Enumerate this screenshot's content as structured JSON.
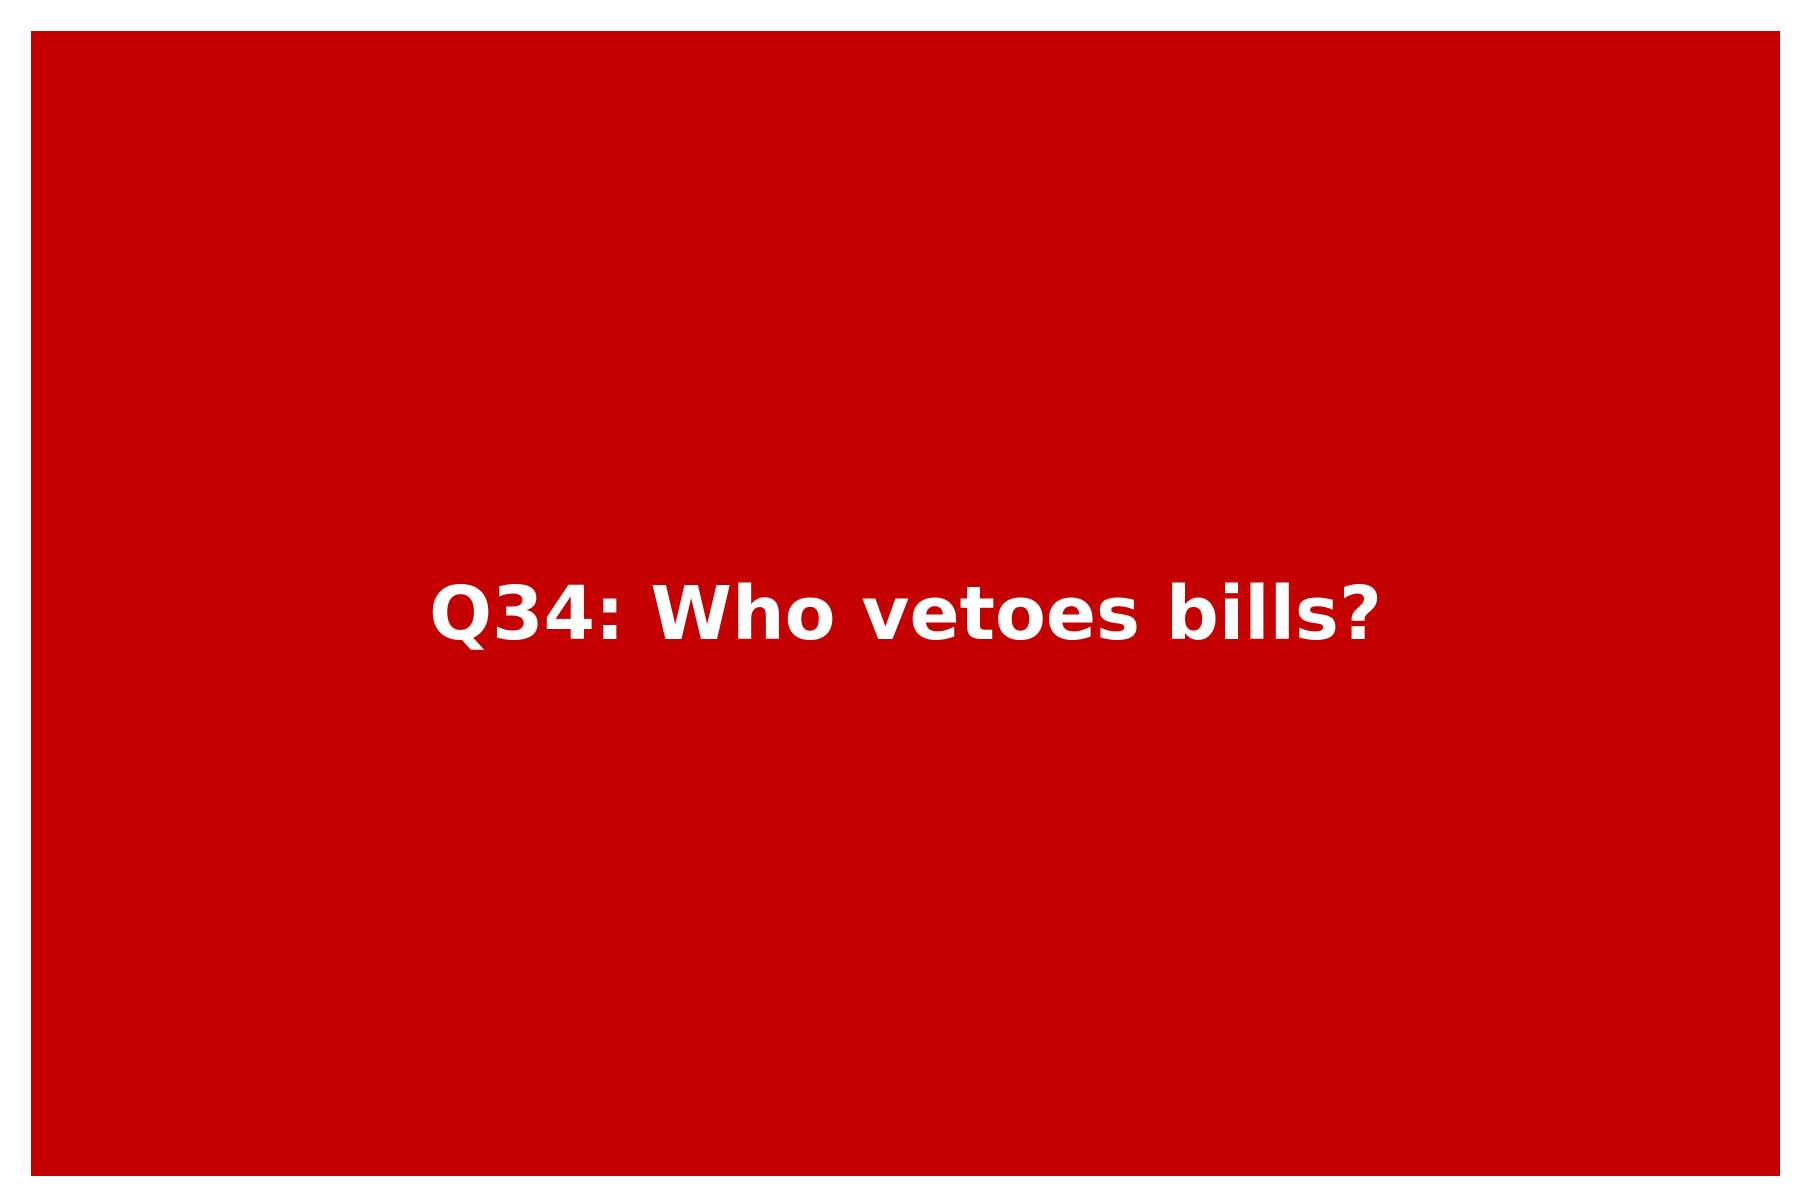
{
  "card": {
    "background_color": "#c40000",
    "text_color": "#ffffff",
    "question_text": "Q34: Who vetoes bills?"
  }
}
